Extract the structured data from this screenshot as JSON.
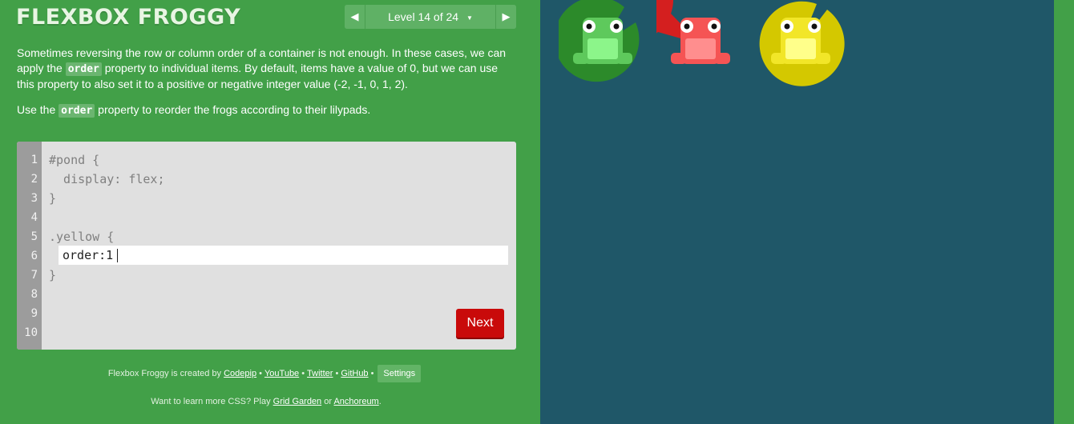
{
  "header": {
    "title": "FLEXBOX FROGGY",
    "level_label": "Level 14 of 24",
    "level_caret": "▼",
    "prev_icon": "◀",
    "next_icon": "▶"
  },
  "instructions": {
    "p1_before": "Sometimes reversing the row or column order of a container is not enough. In these cases, we can apply the ",
    "p1_code": "order",
    "p1_after": " property to individual items. By default, items have a value of 0, but we can use this property to also set it to a positive or negative integer value (-2, -1, 0, 1, 2).",
    "p2_before": "Use the ",
    "p2_code": "order",
    "p2_after": " property to reorder the frogs according to their lilypads."
  },
  "editor": {
    "line_numbers": [
      "1",
      "2",
      "3",
      "4",
      "5",
      "6",
      "7",
      "8",
      "9",
      "10"
    ],
    "line1": "#pond {",
    "line2": "  display: flex;",
    "line3": "}",
    "line5": ".yellow {",
    "line7": "}",
    "input_value": "order:1",
    "next_label": "Next"
  },
  "footer": {
    "created_by": "Flexbox Froggy is created by ",
    "codepip": "Codepip",
    "youtube": "YouTube",
    "twitter": "Twitter",
    "github": "GitHub",
    "bullet": "•",
    "settings": "Settings",
    "more_prefix": "Want to learn more CSS? Play ",
    "grid_garden": "Grid Garden",
    "or": " or ",
    "anchoreum": "Anchoreum",
    "period": "."
  },
  "pond": {
    "lilypads": [
      {
        "color_name": "green",
        "color": "#2c8a2a"
      },
      {
        "color_name": "red",
        "color": "#d41f1f"
      },
      {
        "color_name": "yellow",
        "color": "#d4c800"
      }
    ],
    "frogs": [
      {
        "color_name": "green",
        "body": "#5ec95c",
        "belly": "#8cf58a"
      },
      {
        "color_name": "red",
        "body": "#f55454",
        "belly": "#ff8e8e"
      },
      {
        "color_name": "yellow",
        "body": "#f2e628",
        "belly": "#ffff8a"
      }
    ]
  },
  "colors": {
    "sidebar_bg": "#42a048",
    "pond_bg": "#1f5768",
    "next_button": "#c90a0a",
    "editor_bg": "#e0e0e0"
  }
}
